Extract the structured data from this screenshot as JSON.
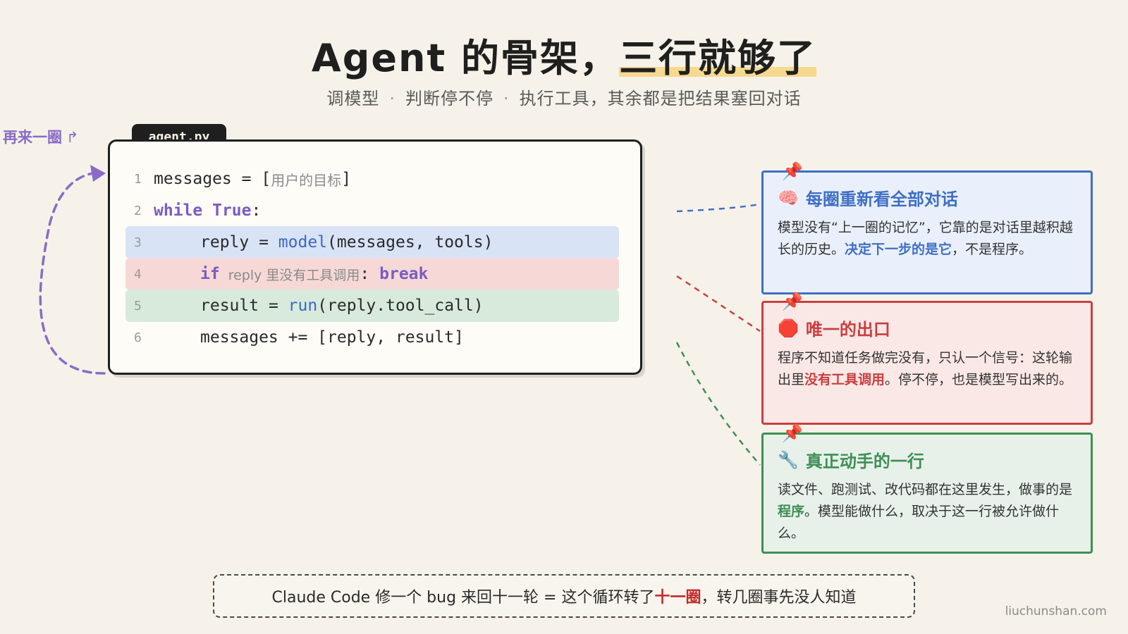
{
  "header": {
    "title_prefix": "Agent 的骨架，",
    "title_highlight": "三行就够了",
    "subtitle_parts": [
      "调模型",
      "判断停不停",
      "执行工具，其余都是把结果塞回对话"
    ],
    "subtitle_separator": "·"
  },
  "loop": {
    "label": "再来一圈",
    "return_glyph": "↱",
    "arrow_color": "#8a6cc6"
  },
  "code": {
    "filename": "agent.py",
    "lines": [
      {
        "num": "1",
        "var": "messages",
        "op": " = ",
        "open": "[",
        "comment": "用户的目标",
        "close": "]"
      },
      {
        "num": "2",
        "kw1": "while",
        "kw2": "True",
        "colon": ":"
      },
      {
        "num": "3",
        "var": "reply",
        "op": " = ",
        "fn": "model",
        "args": "(messages, tools)"
      },
      {
        "num": "4",
        "kw": "if",
        "comment": "reply 里没有工具调用",
        "colon": ":",
        "kw_break": "break"
      },
      {
        "num": "5",
        "var": "result",
        "op": " = ",
        "fn": "run",
        "args": "(reply.tool_call)"
      },
      {
        "num": "6",
        "var": "messages",
        "op": " += ",
        "rest": "[reply, result]"
      }
    ],
    "highlight_colors": {
      "line3": "#d9e3f6",
      "line4": "#f6d9d6",
      "line5": "#d8eadc"
    }
  },
  "notes": [
    {
      "color": "#3f6fc5",
      "pin": "📌",
      "icon": "🧠",
      "title": "每圈重新看全部对话",
      "body_before": "模型没有“上一圈的记忆”，它靠的是对话里越积越长的历史。",
      "body_em": "决定下一步的是它",
      "body_after": "，不是程序。"
    },
    {
      "color": "#c94040",
      "pin": "📌",
      "icon": "🛑",
      "title": "唯一的出口",
      "body_before": "程序不知道任务做完没有，只认一个信号：这轮输出里",
      "body_em": "没有工具调用",
      "body_after": "。停不停，也是模型写出来的。"
    },
    {
      "color": "#3e8f55",
      "pin": "📌",
      "icon": "🔧",
      "title": "真正动手的一行",
      "body_before": "读文件、跑测试、改代码都在这里发生，做事的是",
      "body_em": "程序",
      "body_after": "。模型能做什么，取决于这一行被允许做什么。"
    }
  ],
  "footer": {
    "before": "Claude Code 修一个 bug 来回十一轮 = 这个循环转了",
    "em": "十一圈",
    "after": "，转几圈事先没人知道"
  },
  "site": "liuchunshan.com"
}
